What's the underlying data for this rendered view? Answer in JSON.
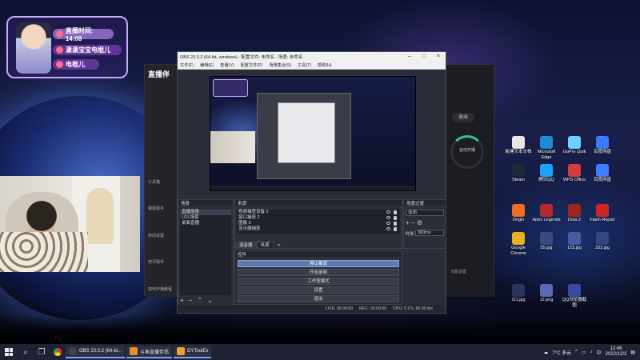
{
  "overlay": {
    "live_time": "直播时间: 14:08",
    "name_row1": "潇潇宝宝电棍儿",
    "name_row2": "电棍儿"
  },
  "zb_app": {
    "logo": "直播伴",
    "nav": [
      "工具箱",
      "弹幕助手",
      "房间设置",
      "虎牙助手",
      "如何开播教程"
    ],
    "right_btn": "退出",
    "ring_label": "自动开播",
    "bottom_hint": "功能设置"
  },
  "obs": {
    "title": "OBS 23.0.2 (64-bit, windows) - 配置文件: 未命名 - 场景: 未命名",
    "menu": [
      "文件(F)",
      "编辑(E)",
      "查看(V)",
      "配置文件(P)",
      "场景集合(S)",
      "工具(T)",
      "帮助(H)"
    ],
    "scenes_title": "场景",
    "scenes": [
      "直播场景",
      "LOL场景",
      "桌面直播"
    ],
    "sources_title": "来源",
    "sources": [
      "视频捕获设备 2",
      "窗口捕获 2",
      "图像 3",
      "显示器捕获"
    ],
    "mixer_title": "场景过渡",
    "mixer_option": "淡出",
    "duration_label": "时长",
    "duration_value": "300ms",
    "tabs": [
      "混音器",
      "来源"
    ],
    "controls_title": "控件",
    "controls": [
      "停止推流",
      "开始录制",
      "工作室模式",
      "设置",
      "退出"
    ],
    "status": {
      "live": "LIVE:",
      "live_time": "00:00:00",
      "rec": "REC:",
      "rec_time": "00:00:00",
      "cpu": "CPU: 0.1%, 60.00 fps"
    }
  },
  "desktop_icons": [
    {
      "label": "新建文本文档",
      "color": "#e7e7e7"
    },
    {
      "label": "Microsoft Edge",
      "color": "#1f8ad6"
    },
    {
      "label": "GoPro Quik",
      "color": "#6bd2ff"
    },
    {
      "label": "百度网盘",
      "color": "#3c7bff"
    },
    {
      "label": "Steam",
      "color": "#1b2838"
    },
    {
      "label": "腾讯QQ",
      "color": "#1aa3ff"
    },
    {
      "label": "WPS Office",
      "color": "#d83b3b"
    },
    {
      "label": "百度网盘",
      "color": "#3f7cff"
    },
    {
      "label": "Origin",
      "color": "#f26b22"
    },
    {
      "label": "Apex Legends",
      "color": "#b52a2a"
    },
    {
      "label": "Dota 2",
      "color": "#a0261d"
    },
    {
      "label": "Flash Repair",
      "color": "#d02525"
    },
    {
      "label": "Google Chrome",
      "color": "#e9b023"
    },
    {
      "label": "55.jpg",
      "color": "#3a4a7a"
    },
    {
      "label": "123.jpg",
      "color": "#4a5aa0"
    },
    {
      "label": "333.jpg",
      "color": "#334680"
    },
    {
      "label": "111.jpg",
      "color": "#2a3560"
    },
    {
      "label": "12.png",
      "color": "#5a6ab0"
    },
    {
      "label": "QQ浏览器截图",
      "color": "#3a4aa0"
    }
  ],
  "taskbar": {
    "apps": [
      "OBS 23.0.2 (64-bi...",
      "斗鱼直播伴侣",
      "DYToolEx"
    ],
    "weather": "7°C 多云",
    "ime": "中",
    "time": "12:46",
    "date": "2022/12/2"
  }
}
